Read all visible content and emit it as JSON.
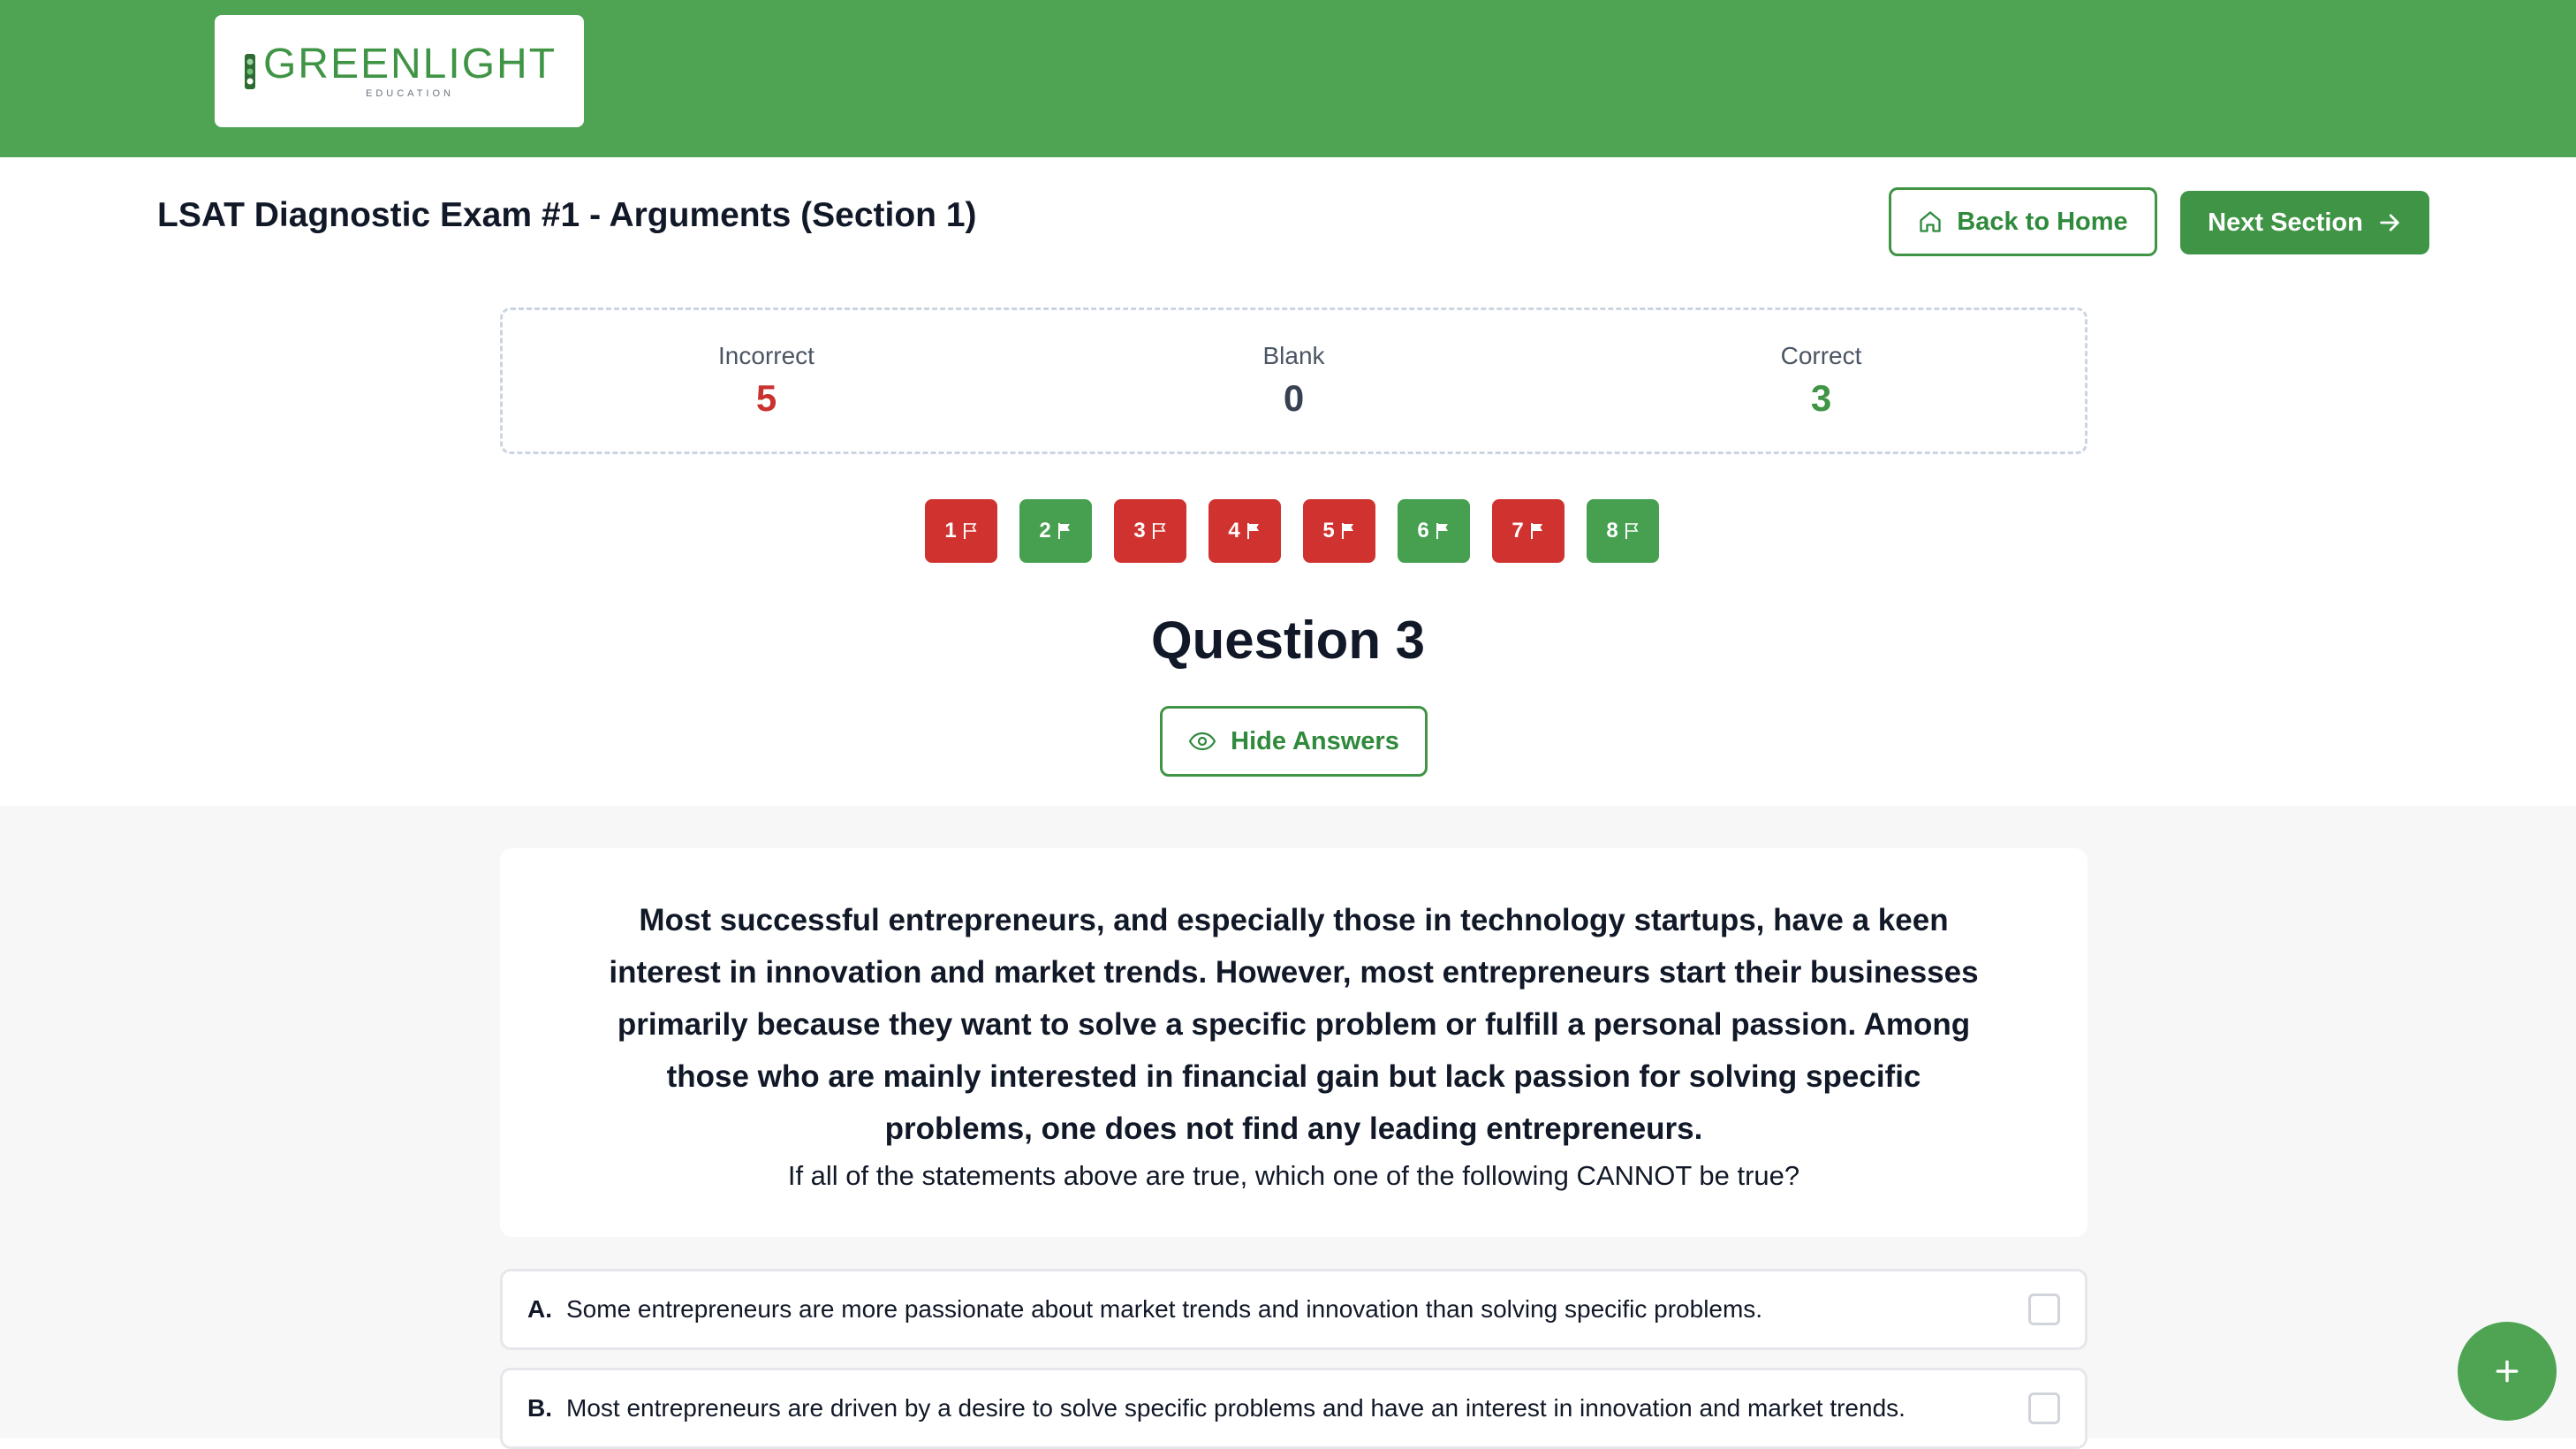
{
  "header": {
    "logo_word": "GREENLIGHT",
    "logo_sub": "EDUCATION",
    "brand_color": "#4ea452"
  },
  "page": {
    "title": "LSAT Diagnostic Exam #1 - Arguments (Section 1)",
    "back_label": "Back to Home",
    "next_label": "Next Section"
  },
  "scores": {
    "incorrect_label": "Incorrect",
    "incorrect_value": "5",
    "blank_label": "Blank",
    "blank_value": "0",
    "correct_label": "Correct",
    "correct_value": "3"
  },
  "question_nav": [
    {
      "label": "1",
      "status": "incorrect",
      "flag": "outline"
    },
    {
      "label": "2",
      "status": "correct",
      "flag": "filled"
    },
    {
      "label": "3",
      "status": "incorrect",
      "flag": "outline"
    },
    {
      "label": "4",
      "status": "incorrect",
      "flag": "filled"
    },
    {
      "label": "5",
      "status": "incorrect",
      "flag": "filled"
    },
    {
      "label": "6",
      "status": "correct",
      "flag": "filled"
    },
    {
      "label": "7",
      "status": "incorrect",
      "flag": "filled"
    },
    {
      "label": "8",
      "status": "correct",
      "flag": "outline"
    }
  ],
  "question": {
    "heading": "Question 3",
    "hide_label": "Hide Answers",
    "stimulus": "Most successful entrepreneurs, and especially those in technology startups, have a keen interest in innovation and market trends. However, most entrepreneurs start their businesses primarily because they want to solve a specific problem or fulfill a personal passion. Among those who are mainly interested in financial gain but lack passion for solving specific problems, one does not find any leading entrepreneurs.",
    "stem": "If all of the statements above are true, which one of the following CANNOT be true?",
    "options": [
      {
        "letter": "A.",
        "text": "Some entrepreneurs are more passionate about market trends and innovation than solving specific problems."
      },
      {
        "letter": "B.",
        "text": "Most entrepreneurs are driven by a desire to solve specific problems and have an interest in innovation and market trends."
      }
    ]
  },
  "colors": {
    "correct": "#46a050",
    "incorrect": "#d0332f"
  }
}
